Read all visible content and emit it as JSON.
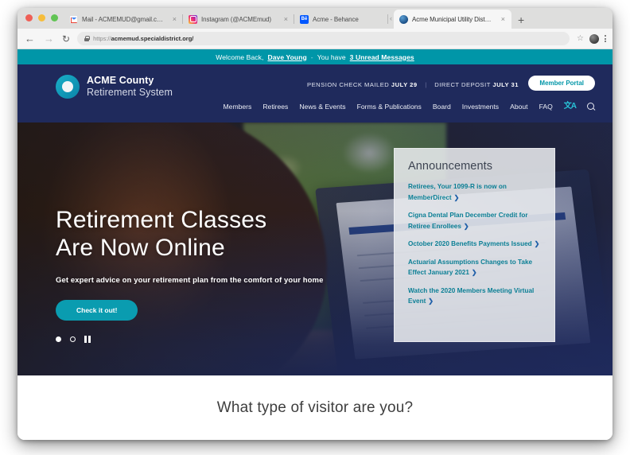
{
  "browser": {
    "tabs": [
      {
        "title": "Mail - ACMEMUD@gmail.com",
        "favicon": "gmail-icon",
        "active": false,
        "close": "×"
      },
      {
        "title": "Instagram (@ACMEmud)",
        "favicon": "instagram-icon",
        "active": false,
        "close": "×"
      },
      {
        "title": "Acme - Behance",
        "favicon": "behance-icon",
        "active": false,
        "close": "×"
      },
      {
        "title": "Acme Municipal Utility District",
        "favicon": "acme-globe-icon",
        "active": true,
        "close": "×"
      }
    ],
    "new_tab_label": "+",
    "scroll_left_label": "‹",
    "toolbar": {
      "back_label": "←",
      "forward_label": "→",
      "reload_label": "↻",
      "url_scheme": "https://",
      "url_host": "acmemud.specialdistrict.org",
      "url_path": "/",
      "lock_icon": "lock-icon",
      "star_label": "☆",
      "avatar_name": "profile-avatar",
      "menu_label": "kebab-menu-icon"
    }
  },
  "site": {
    "welcome": {
      "greeting": "Welcome Back,",
      "user_name": "Dave Young",
      "separator": "-",
      "messages_prefix": "You have",
      "messages_link": "3 Unread Messages"
    },
    "header": {
      "logo_line1": "ACME County",
      "logo_line2": "Retirement System",
      "pension_label": "PENSION CHECK MAILED",
      "pension_date": "JULY 29",
      "divider": "|",
      "deposit_label": "DIRECT DEPOSIT",
      "deposit_date": "JULY 31",
      "portal_button": "Member Portal",
      "nav": [
        {
          "label": "Members"
        },
        {
          "label": "Retirees"
        },
        {
          "label": "News & Events"
        },
        {
          "label": "Forms & Publications"
        },
        {
          "label": "Board"
        },
        {
          "label": "Investments"
        },
        {
          "label": "About"
        },
        {
          "label": "FAQ"
        }
      ],
      "translate_glyph": "文A",
      "search_name": "search-icon"
    },
    "hero": {
      "headline_line1": "Retirement Classes",
      "headline_line2": "Are Now Online",
      "subhead": "Get expert advice on your retirement plan from the comfort of your home",
      "cta_label": "Check it out!",
      "slide_count": 2,
      "active_slide": 1,
      "pause_label": "pause"
    },
    "announcements": {
      "title": "Announcements",
      "chevron": "❯",
      "items": [
        {
          "text": "Retirees, Your 1099-R is now on MemberDirect"
        },
        {
          "text": "Cigna Dental Plan December Credit for Retiree Enrollees"
        },
        {
          "text": "October 2020 Benefits Payments Issued"
        },
        {
          "text": "Actuarial Assumptions Changes to Take Effect January 2021"
        },
        {
          "text": "Watch the 2020 Members Meeting Virtual Event"
        }
      ]
    },
    "visitor_section": {
      "question": "What type of visitor are you?"
    }
  },
  "colors": {
    "teal": "#0096a8",
    "navy": "#1f2a5c",
    "link_teal": "#0b7f95",
    "cta_teal": "#0a9cb0"
  }
}
